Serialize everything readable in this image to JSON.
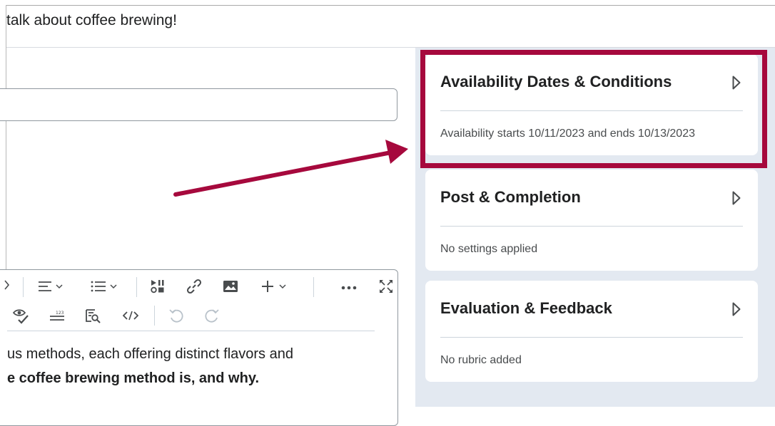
{
  "topic": {
    "title": "talk about coffee brewing!"
  },
  "editor": {
    "content_line_1": "us methods, each offering distinct flavors and",
    "content_line_2": "e coffee brewing method is, and why."
  },
  "cards": [
    {
      "title": "Availability Dates & Conditions",
      "summary": "Availability starts 10/11/2023 and ends 10/13/2023"
    },
    {
      "title": "Post & Completion",
      "summary": "No settings applied"
    },
    {
      "title": "Evaluation & Feedback",
      "summary": "No rubric added"
    }
  ],
  "colors": {
    "highlight": "#a6093d",
    "side_panel": "#e3e9f1"
  },
  "icons": {
    "toolbar_row1": [
      "chevron-right-icon",
      "align-icon",
      "list-icon",
      "media-icon",
      "link-icon",
      "image-icon",
      "plus-icon",
      "more-icon",
      "fullscreen-icon"
    ],
    "toolbar_row2": [
      "accessibility-check-icon",
      "word-count-icon",
      "preview-icon",
      "source-code-icon",
      "undo-icon",
      "redo-icon"
    ],
    "card_chevron": "triangle-right-icon"
  }
}
